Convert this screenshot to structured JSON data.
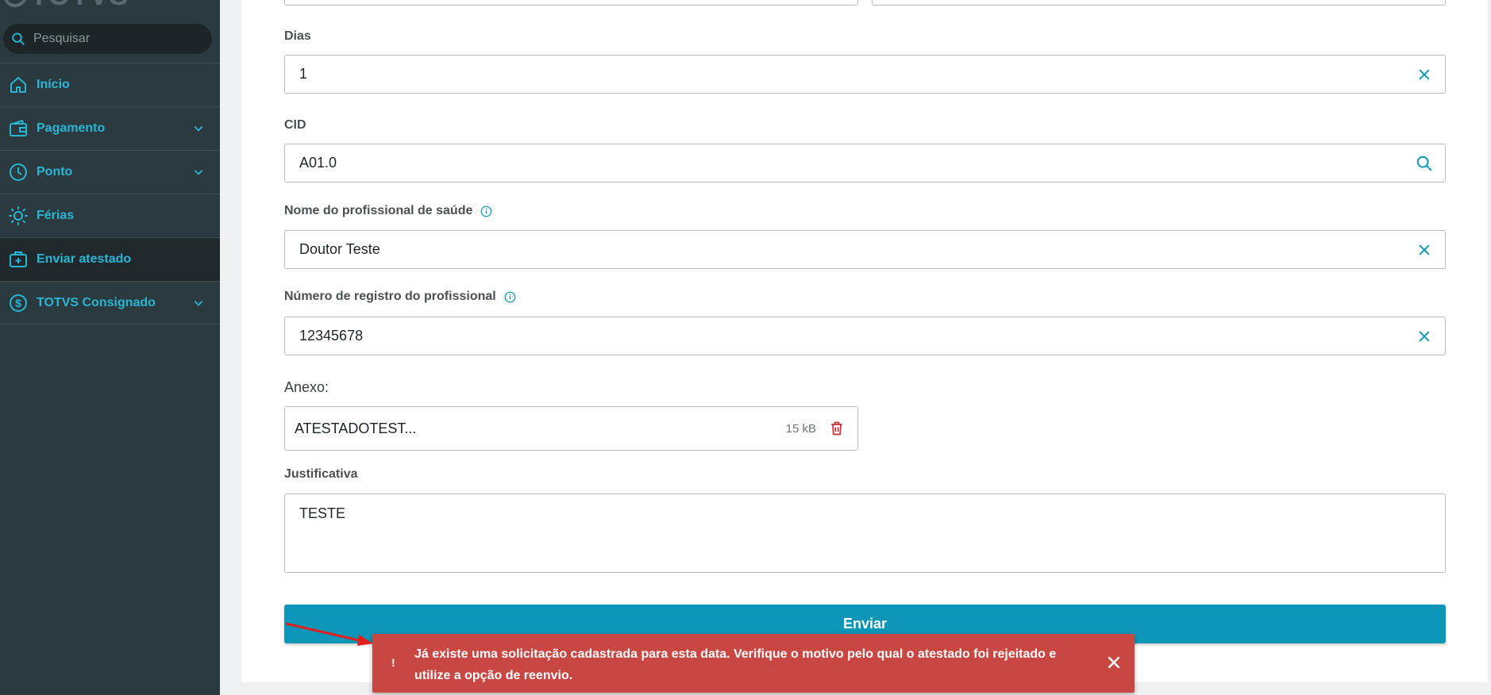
{
  "app": {
    "logo_text": "TOTVS"
  },
  "search": {
    "placeholder": "Pesquisar"
  },
  "sidebar": {
    "items": [
      {
        "label": "Início",
        "icon": "home-icon",
        "has_chevron": false,
        "active": false
      },
      {
        "label": "Pagamento",
        "icon": "wallet-icon",
        "has_chevron": true,
        "active": false
      },
      {
        "label": "Ponto",
        "icon": "clock-icon",
        "has_chevron": true,
        "active": false
      },
      {
        "label": "Férias",
        "icon": "sun-icon",
        "has_chevron": false,
        "active": false
      },
      {
        "label": "Enviar atestado",
        "icon": "medical-bag-icon",
        "has_chevron": false,
        "active": true
      },
      {
        "label": "TOTVS Consignado",
        "icon": "dollar-coin-icon",
        "has_chevron": true,
        "active": false
      }
    ]
  },
  "form": {
    "dias": {
      "label": "Dias",
      "value": "1"
    },
    "cid": {
      "label": "CID",
      "value": "A01.0"
    },
    "profissional": {
      "label": "Nome do profissional de saúde",
      "value": "Doutor Teste"
    },
    "registro": {
      "label": "Número de registro do profissional",
      "value": "12345678"
    },
    "anexo": {
      "label": "Anexo:",
      "file_name": "ATESTADOTEST...",
      "file_size": "15 kB"
    },
    "justificativa": {
      "label": "Justificativa",
      "value": "TESTE"
    },
    "submit_label": "Enviar"
  },
  "toast": {
    "icon": "!",
    "message": "Já existe uma solicitação cadastrada para esta data. Verifique o motivo pelo qual o atestado foi rejeitado e utilize a opção de reenvio."
  },
  "colors": {
    "sidebar_bg": "#2b3a3f",
    "accent": "#29b6d6",
    "primary_button": "#0e96b8",
    "error_toast": "#c94742",
    "delete_icon": "#c9323a"
  }
}
